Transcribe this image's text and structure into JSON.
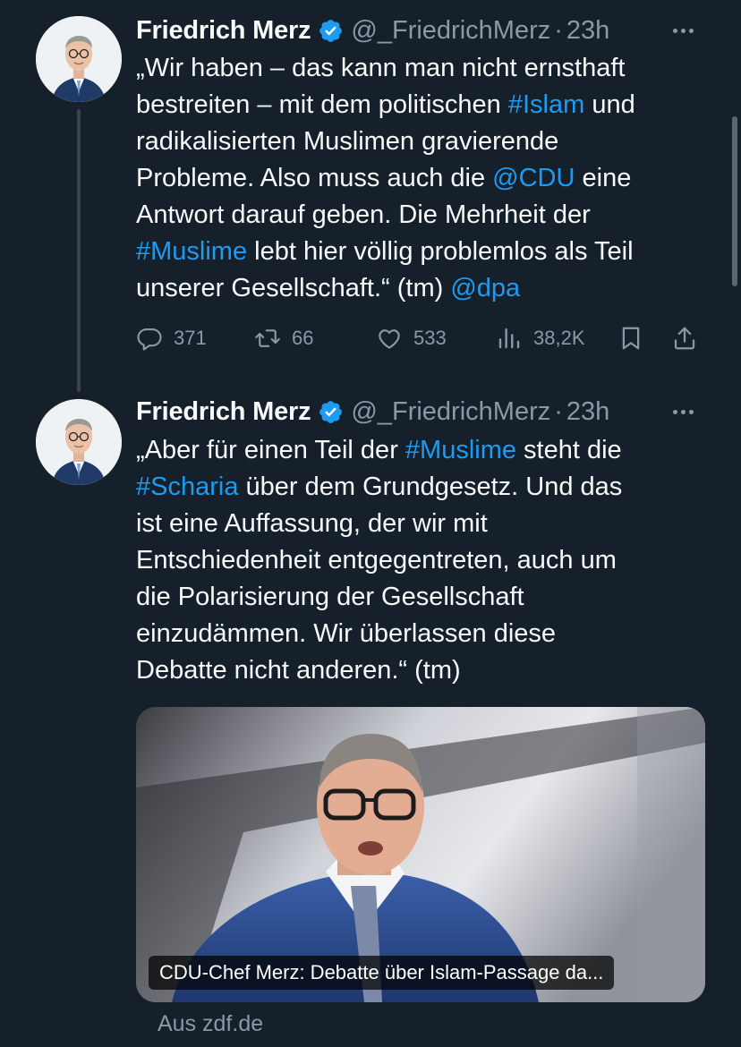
{
  "tweets": [
    {
      "author_name": "Friedrich Merz",
      "handle": "@_FriedrichMerz",
      "separator": "·",
      "time": "23h",
      "lines": [
        [
          {
            "t": "„Wir haben – das kann man nicht ernsthaft"
          }
        ],
        [
          {
            "t": "bestreiten – mit dem politischen "
          },
          {
            "t": "#Islam",
            "link": true
          },
          {
            "t": " und"
          }
        ],
        [
          {
            "t": "radikalisierten Muslimen gravierende"
          }
        ],
        [
          {
            "t": "Probleme. Also muss auch die "
          },
          {
            "t": "@CDU",
            "link": true
          },
          {
            "t": " eine"
          }
        ],
        [
          {
            "t": "Antwort darauf geben. Die Mehrheit der"
          }
        ],
        [
          {
            "t": "#Muslime",
            "link": true
          },
          {
            "t": " lebt hier völlig problemlos als Teil"
          }
        ],
        [
          {
            "t": "unserer Gesellschaft.“ (tm) "
          },
          {
            "t": "@dpa",
            "link": true
          }
        ]
      ],
      "stats": {
        "replies": "371",
        "reposts": "66",
        "likes": "533",
        "views": "38,2K"
      }
    },
    {
      "author_name": "Friedrich Merz",
      "handle": "@_FriedrichMerz",
      "separator": "·",
      "time": "23h",
      "lines": [
        [
          {
            "t": "„Aber für einen Teil der "
          },
          {
            "t": "#Muslime",
            "link": true
          },
          {
            "t": " steht die"
          }
        ],
        [
          {
            "t": "#Scharia",
            "link": true
          },
          {
            "t": " über dem Grundgesetz. Und das"
          }
        ],
        [
          {
            "t": "ist eine Auffassung, der wir mit"
          }
        ],
        [
          {
            "t": "Entschiedenheit entgegentreten, auch um"
          }
        ],
        [
          {
            "t": "die Polarisierung der Gesellschaft"
          }
        ],
        [
          {
            "t": "einzudämmen. Wir überlassen diese"
          }
        ],
        [
          {
            "t": "Debatte nicht anderen.“ (tm)"
          }
        ]
      ],
      "link_card": {
        "title": "CDU-Chef Merz: Debatte über Islam-Passage da...",
        "source": "Aus zdf.de"
      }
    }
  ],
  "icons": {
    "verified": "verified-badge-icon",
    "more": "more-options-icon",
    "reply": "reply-icon",
    "repost": "repost-icon",
    "like": "like-icon",
    "views": "views-icon",
    "bookmark": "bookmark-icon",
    "share": "share-icon"
  },
  "colors": {
    "background": "#15202b",
    "text": "#f7f9f9",
    "secondary_text": "#8b98a5",
    "link": "#1d9bf0",
    "verified": "#1d9bf0"
  }
}
